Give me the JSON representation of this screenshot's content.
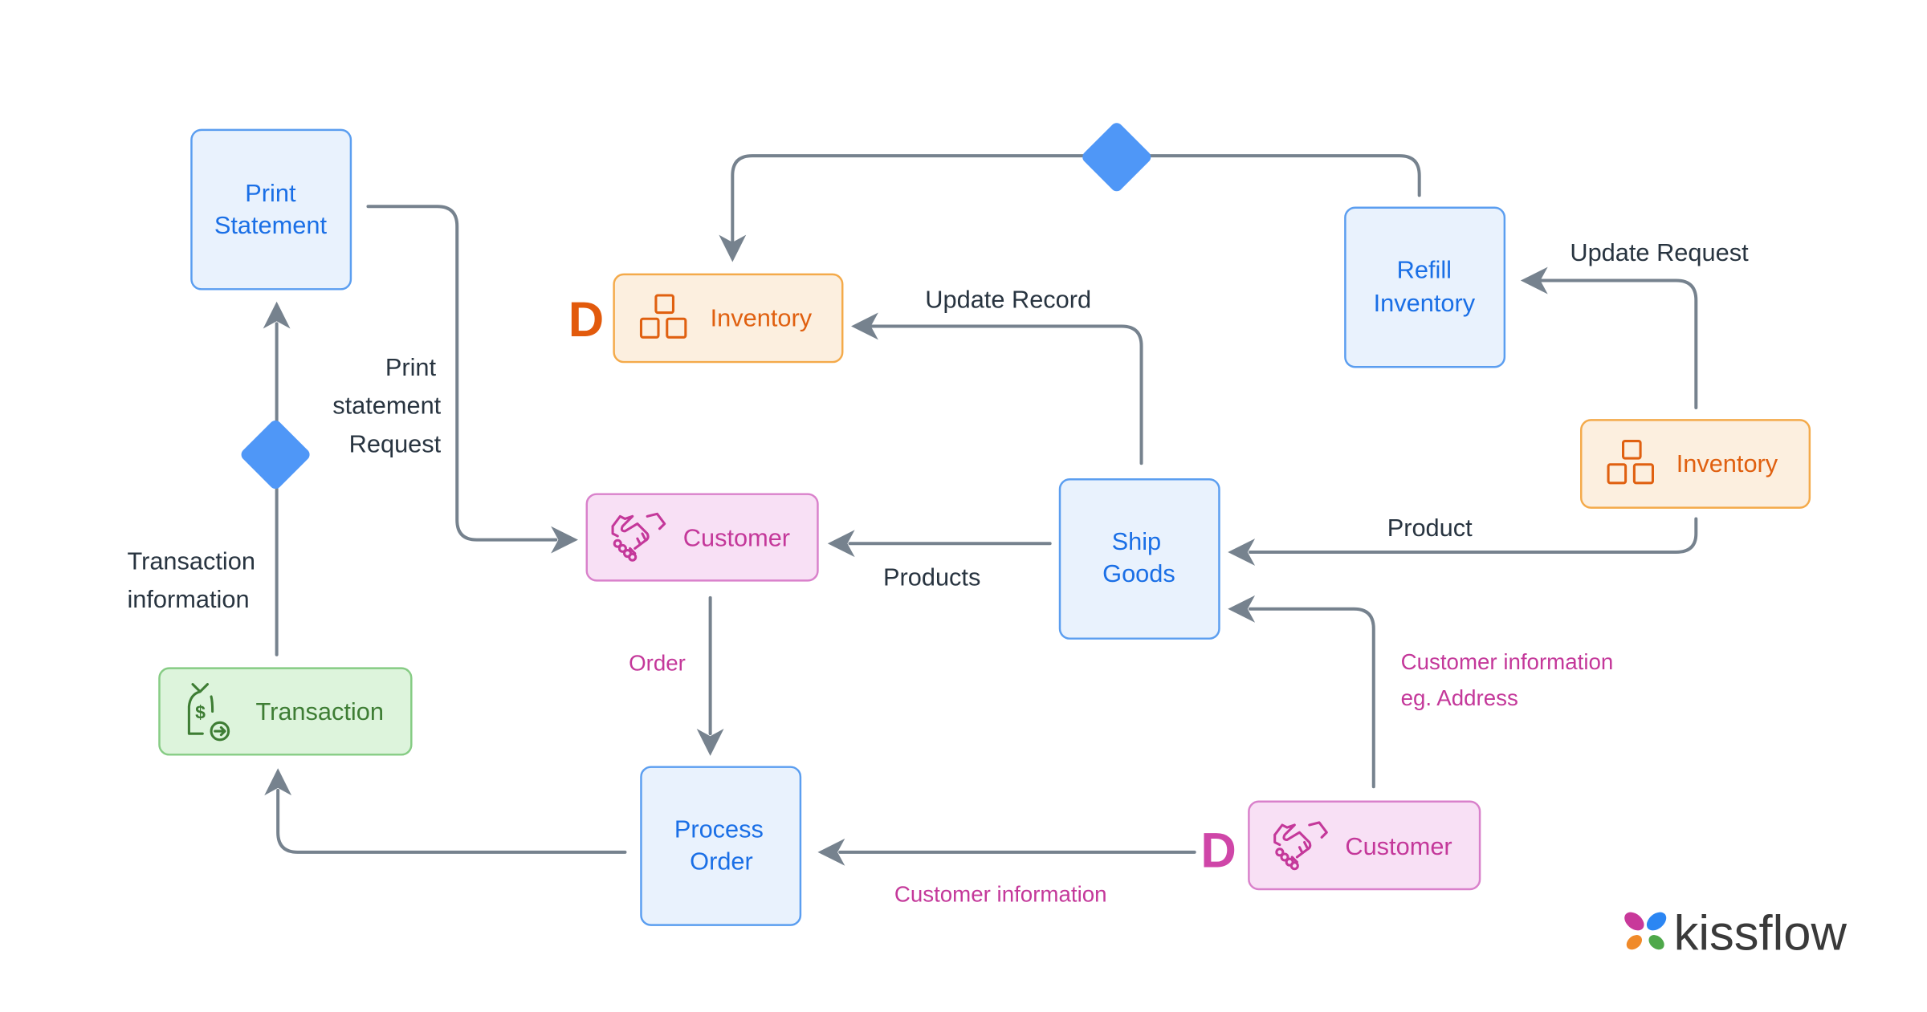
{
  "diagram": {
    "nodes": {
      "print_statement": {
        "line1": "Print",
        "line2": "Statement"
      },
      "refill_inventory": {
        "line1": "Refill",
        "line2": "Inventory"
      },
      "ship_goods": {
        "line1": "Ship",
        "line2": "Goods"
      },
      "process_order": {
        "line1": "Process",
        "line2": "Order"
      },
      "inventory_top": {
        "label": "Inventory",
        "marker": "D"
      },
      "inventory_right": {
        "label": "Inventory"
      },
      "customer_center": {
        "label": "Customer"
      },
      "customer_bottom": {
        "label": "Customer",
        "marker": "D"
      },
      "transaction": {
        "label": "Transaction"
      }
    },
    "edge_labels": {
      "update_record": "Update Record",
      "update_request": "Update Request",
      "print_request_1": "Print",
      "print_request_2": "statement",
      "print_request_3": "Request",
      "transaction_info_1": "Transaction",
      "transaction_info_2": "information",
      "products": "Products",
      "product": "Product",
      "order": "Order",
      "customer_info_addr_1": "Customer information",
      "customer_info_addr_2": "eg. Address",
      "customer_information": "Customer information"
    },
    "icons": {
      "inventory": "boxes-icon",
      "customer": "handshake-icon",
      "transaction": "money-bag-icon",
      "decision": "diamond-icon"
    }
  },
  "logo": {
    "text": "kissflow",
    "petal_colors": [
      "#c8399a",
      "#2b86f3",
      "#f08a2a",
      "#4ea84a"
    ]
  },
  "colors": {
    "process": "#1a6fe6",
    "datastore": "#e06010",
    "entity": "#c4389a",
    "transaction": "#3e7d34",
    "edge": "#76828e",
    "decision": "#4f97f7"
  }
}
